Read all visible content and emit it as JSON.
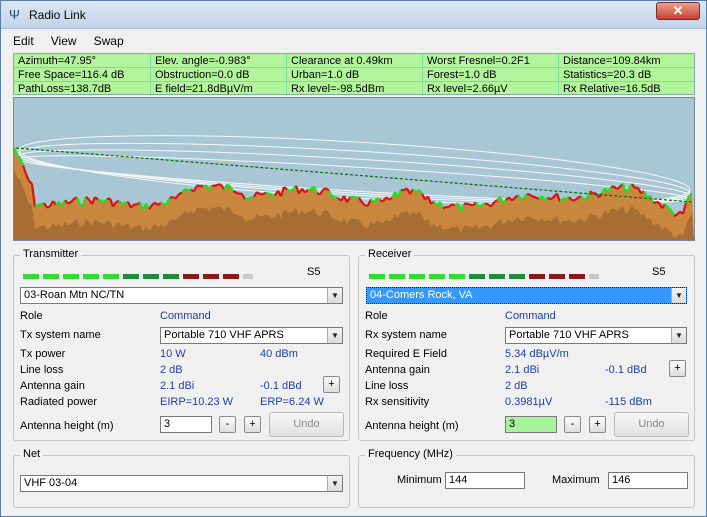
{
  "window": {
    "title": "Radio Link",
    "close_glyph": "✕"
  },
  "menu": [
    "Edit",
    "View",
    "Swap"
  ],
  "stats": {
    "rows": [
      [
        "Azimuth=47.95°",
        "Elev. angle=-0.983°",
        "Clearance at 0.49km",
        "Worst Fresnel=0.2F1",
        "Distance=109.84km"
      ],
      [
        "Free Space=116.4 dB",
        "Obstruction=0.0 dB",
        "Urban=1.0 dB",
        "Forest=1.0 dB",
        "Statistics=20.3 dB"
      ],
      [
        "PathLoss=138.7dB",
        "E field=21.8dBµV/m",
        "Rx level=-98.5dBm",
        "Rx level=2.66µV",
        "Rx Relative=16.5dB"
      ]
    ]
  },
  "colors": {
    "meter_green_bright": "#32dd32",
    "meter_green_dark": "#1f8a3a",
    "meter_red": "#8a1a1a",
    "meter_gray": "#c8c8c8",
    "sky": "#a8c6d4",
    "terrain": "#c8863e",
    "terrain_dark": "#8c5a28",
    "profile_green": "#22dd22",
    "profile_red": "#dd1111",
    "los_line": "#0b6b0b",
    "fresnel": "#f8f8f8"
  },
  "transmitter": {
    "legend": "Transmitter",
    "signal_label": "S5",
    "site": "03-Roan Mtn NC/TN",
    "role_label": "Role",
    "role_value": "Command",
    "system_label": "Tx system name",
    "system_value": "Portable 710 VHF APRS",
    "power_label": "Tx power",
    "power_w": "10 W",
    "power_dbm": "40 dBm",
    "line_loss_label": "Line loss",
    "line_loss_value": "2 dB",
    "gain_label": "Antenna gain",
    "gain_dbi": "2.1 dBi",
    "gain_dbd": "-0.1 dBd",
    "plus": "+",
    "radiated_label": "Radiated power",
    "eirp": "EIRP=10.23 W",
    "erp": "ERP=6.24 W",
    "height_label": "Antenna height (m)",
    "height_value": "3",
    "minus": "-",
    "undo": "Undo"
  },
  "receiver": {
    "legend": "Receiver",
    "signal_label": "S5",
    "site": "04-Comers Rock, VA",
    "role_label": "Role",
    "role_value": "Command",
    "system_label": "Rx system name",
    "system_value": "Portable 710 VHF APRS",
    "efield_label": "Required E Field",
    "efield_value": "5.34 dBµV/m",
    "gain_label": "Antenna gain",
    "gain_dbi": "2.1 dBi",
    "gain_dbd": "-0.1 dBd",
    "plus": "+",
    "line_loss_label": "Line loss",
    "line_loss_value": "2 dB",
    "sens_label": "Rx sensitivity",
    "sens_uv": "0.3981µV",
    "sens_dbm": "-115 dBm",
    "height_label": "Antenna height (m)",
    "height_value": "3",
    "minus": "-",
    "undo": "Undo"
  },
  "net": {
    "legend": "Net",
    "value": "VHF 03-04"
  },
  "frequency": {
    "legend": "Frequency (MHz)",
    "min_label": "Minimum",
    "min_value": "144",
    "max_label": "Maximum",
    "max_value": "146"
  }
}
